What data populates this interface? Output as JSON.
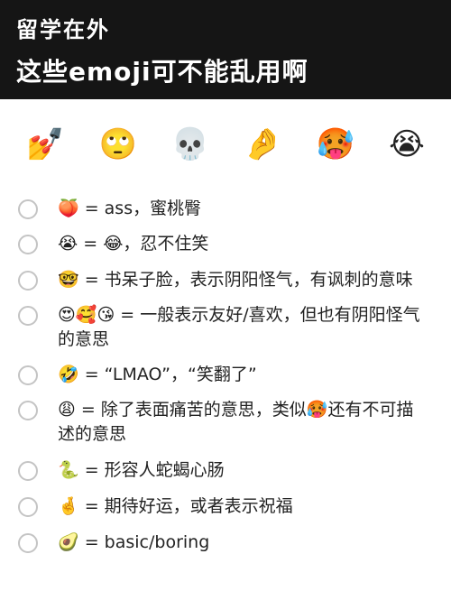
{
  "header": {
    "line1": "留学在外",
    "line2": "这些emoji可不能乱用啊"
  },
  "emoji_row": [
    "💅",
    "🙄",
    "💀",
    "🤌",
    "🥵",
    "😭"
  ],
  "items": [
    "🍑 = ass，蜜桃臀",
    "😭 = 😂，忍不住笑",
    "🤓 = 书呆子脸，表示阴阳怪气，有讽刺的意味",
    "😍🥰😘 = 一般表示友好/喜欢，但也有阴阳怪气的意思",
    "🤣 = “LMAO”，“笑翻了”",
    "😩 = 除了表面痛苦的意思，类似🥵还有不可描述的意思",
    "🐍 = 形容人蛇蝎心肠",
    "🤞 = 期待好运，或者表示祝福",
    "🥑 = basic/boring"
  ]
}
